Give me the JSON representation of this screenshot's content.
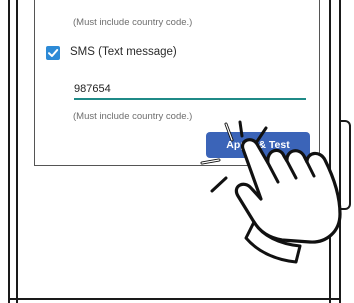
{
  "form": {
    "email_hint": "(Must include country code.)",
    "sms_checkbox_checked": true,
    "sms_label": "SMS (Text message)",
    "phone_value": "987654",
    "phone_hint": "(Must include country code.)",
    "apply_button_label": "Apply & Test"
  },
  "colors": {
    "checkbox": "#2d8ad6",
    "input_underline": "#1f8a87",
    "apply_button": "#3b64b8"
  },
  "icons": {
    "checkbox_mark": "checkmark-icon",
    "pointer": "tapping-hand-icon"
  }
}
